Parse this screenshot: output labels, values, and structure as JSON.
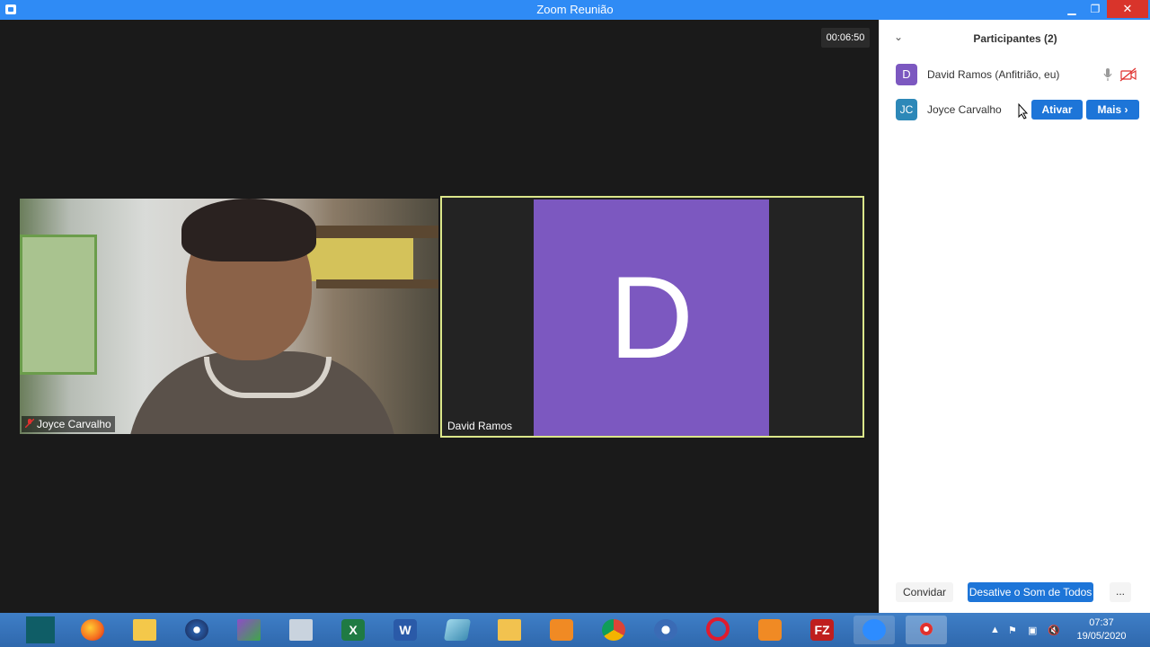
{
  "window": {
    "title": "Zoom Reunião",
    "controls": {
      "minimize": "▁",
      "maximize": "❐",
      "close": "✕"
    }
  },
  "meeting": {
    "timer": "00:06:50",
    "tiles": [
      {
        "name": "Joyce Carvalho",
        "muted": true
      },
      {
        "name": "David Ramos",
        "avatar_letter": "D",
        "avatar_color": "#7c58c0",
        "active_speaker_border": "#dbe68a"
      }
    ]
  },
  "participants_panel": {
    "title": "Participantes (2)",
    "participants": [
      {
        "initials": "D",
        "name": "David Ramos (Anfitrião, eu)",
        "avatar_color": "#7c58c0"
      },
      {
        "initials": "JC",
        "name": "Joyce Carvalho",
        "avatar_color": "#2d88b8",
        "actions": {
          "activate": "Ativar",
          "more": "Mais"
        }
      }
    ],
    "footer": {
      "invite": "Convidar",
      "mute_all": "Desative o Som de Todos",
      "more": "..."
    }
  },
  "taskbar": {
    "apps": [
      {
        "name": "start",
        "label": ""
      },
      {
        "name": "firefox",
        "label": ""
      },
      {
        "name": "mail",
        "label": ""
      },
      {
        "name": "media-player",
        "label": ""
      },
      {
        "name": "photos",
        "label": ""
      },
      {
        "name": "calculator",
        "label": ""
      },
      {
        "name": "excel",
        "label": "X"
      },
      {
        "name": "word",
        "label": "W"
      },
      {
        "name": "notes",
        "label": ""
      },
      {
        "name": "explorer",
        "label": ""
      },
      {
        "name": "app-orange",
        "label": ""
      },
      {
        "name": "chrome",
        "label": ""
      },
      {
        "name": "video-app",
        "label": ""
      },
      {
        "name": "opera",
        "label": ""
      },
      {
        "name": "vlc-like",
        "label": ""
      },
      {
        "name": "filezilla",
        "label": "FZ"
      },
      {
        "name": "zoom",
        "label": ""
      },
      {
        "name": "record",
        "label": ""
      }
    ],
    "clock_time": "07:37",
    "clock_date": "19/05/2020"
  }
}
